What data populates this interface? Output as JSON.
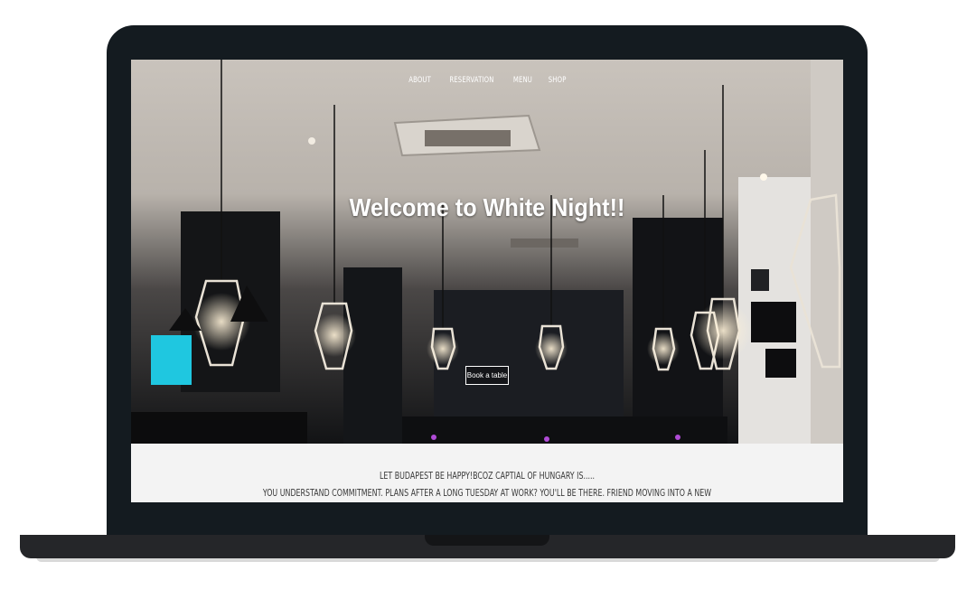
{
  "nav": {
    "items": [
      {
        "label": "ABOUT"
      },
      {
        "label": "RESERVATION"
      },
      {
        "label": "MENU"
      },
      {
        "label": "SHOP"
      }
    ]
  },
  "hero": {
    "title": "Welcome to White Night!!",
    "cta_label": "Book a table"
  },
  "about": {
    "line1": "LET BUDAPEST BE HAPPY!BCOZ CAPTIAL OF HUNGARY IS.....",
    "line2": "YOU UNDERSTAND COMMITMENT. PLANS AFTER A LONG TUESDAY AT WORK? YOU'LL BE THERE. FRIEND MOVING INTO A NEW"
  },
  "colors": {
    "bezel": "#141b20",
    "base": "#252629",
    "about_bg": "#f3f3f3",
    "text": "#3a3a3a"
  }
}
